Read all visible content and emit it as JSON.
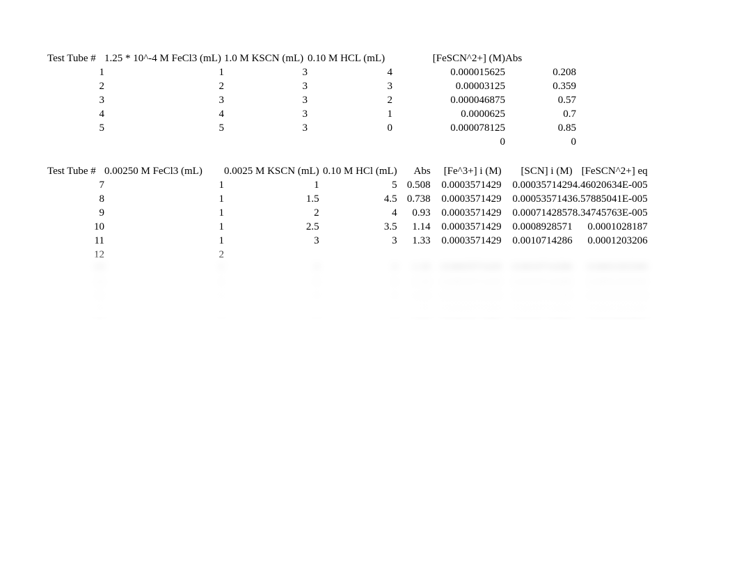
{
  "table1": {
    "headers": [
      "Test Tube #",
      "1.25 * 10^-4 M FeCl3 (mL)",
      "1.0 M KSCN (mL)",
      "0.10 M HCL (mL)",
      "[FeSCN^2+] (M)",
      "Abs"
    ],
    "rows": [
      [
        "1",
        "1",
        "3",
        "4",
        "0.000015625",
        "0.208"
      ],
      [
        "2",
        "2",
        "3",
        "3",
        "0.00003125",
        "0.359"
      ],
      [
        "3",
        "3",
        "3",
        "2",
        "0.000046875",
        "0.57"
      ],
      [
        "4",
        "4",
        "3",
        "1",
        "0.0000625",
        "0.7"
      ],
      [
        "5",
        "5",
        "3",
        "0",
        "0.000078125",
        "0.85"
      ],
      [
        "",
        "",
        "",
        "",
        "0",
        "0"
      ]
    ]
  },
  "table2": {
    "headers": [
      "Test Tube #",
      "0.00250 M FeCl3 (mL)",
      "0.0025 M KSCN (mL)",
      "0.10 M HCl (mL)",
      "Abs",
      "[Fe^3+] i (M)",
      "[SCN] i (M)",
      "[FeSCN^2+] eq"
    ],
    "rows": [
      [
        "7",
        "1",
        "1",
        "5",
        "0.508",
        "0.0003571429",
        "0.0003571429",
        "4.46020634E-005"
      ],
      [
        "8",
        "1",
        "1.5",
        "4.5",
        "0.738",
        "0.0003571429",
        "0.0005357143",
        "6.57885041E-005"
      ],
      [
        "9",
        "1",
        "2",
        "4",
        "0.93",
        "0.0003571429",
        "0.0007142857",
        "8.34745763E-005"
      ],
      [
        "10",
        "1",
        "2.5",
        "3.5",
        "1.14",
        "0.0003571429",
        "0.0008928571",
        "0.0001028187"
      ],
      [
        "11",
        "1",
        "3",
        "3",
        "1.33",
        "0.0003571429",
        "0.0010714286",
        "0.0001203206"
      ],
      [
        "12",
        "2",
        "",
        "",
        "",
        "",
        "",
        ""
      ]
    ],
    "blurred_rows": [
      [
        "13",
        "1",
        "3",
        "3",
        "1.33",
        "0.0003571429",
        "0.0010714286",
        "0.0001203206"
      ],
      [
        "14",
        "1",
        "3",
        "3",
        "1.33",
        "0.0003571429",
        "0.0010714286",
        "0.0001203206"
      ],
      [
        "15",
        "1",
        "3",
        "3",
        "1.33",
        "0.0003571429",
        "0.0010714286",
        "0.0001203206"
      ],
      [
        "16",
        "1",
        "3",
        "3",
        "1.33",
        "0.0003571429",
        "0.0010714286",
        "0.0001203206"
      ]
    ]
  }
}
